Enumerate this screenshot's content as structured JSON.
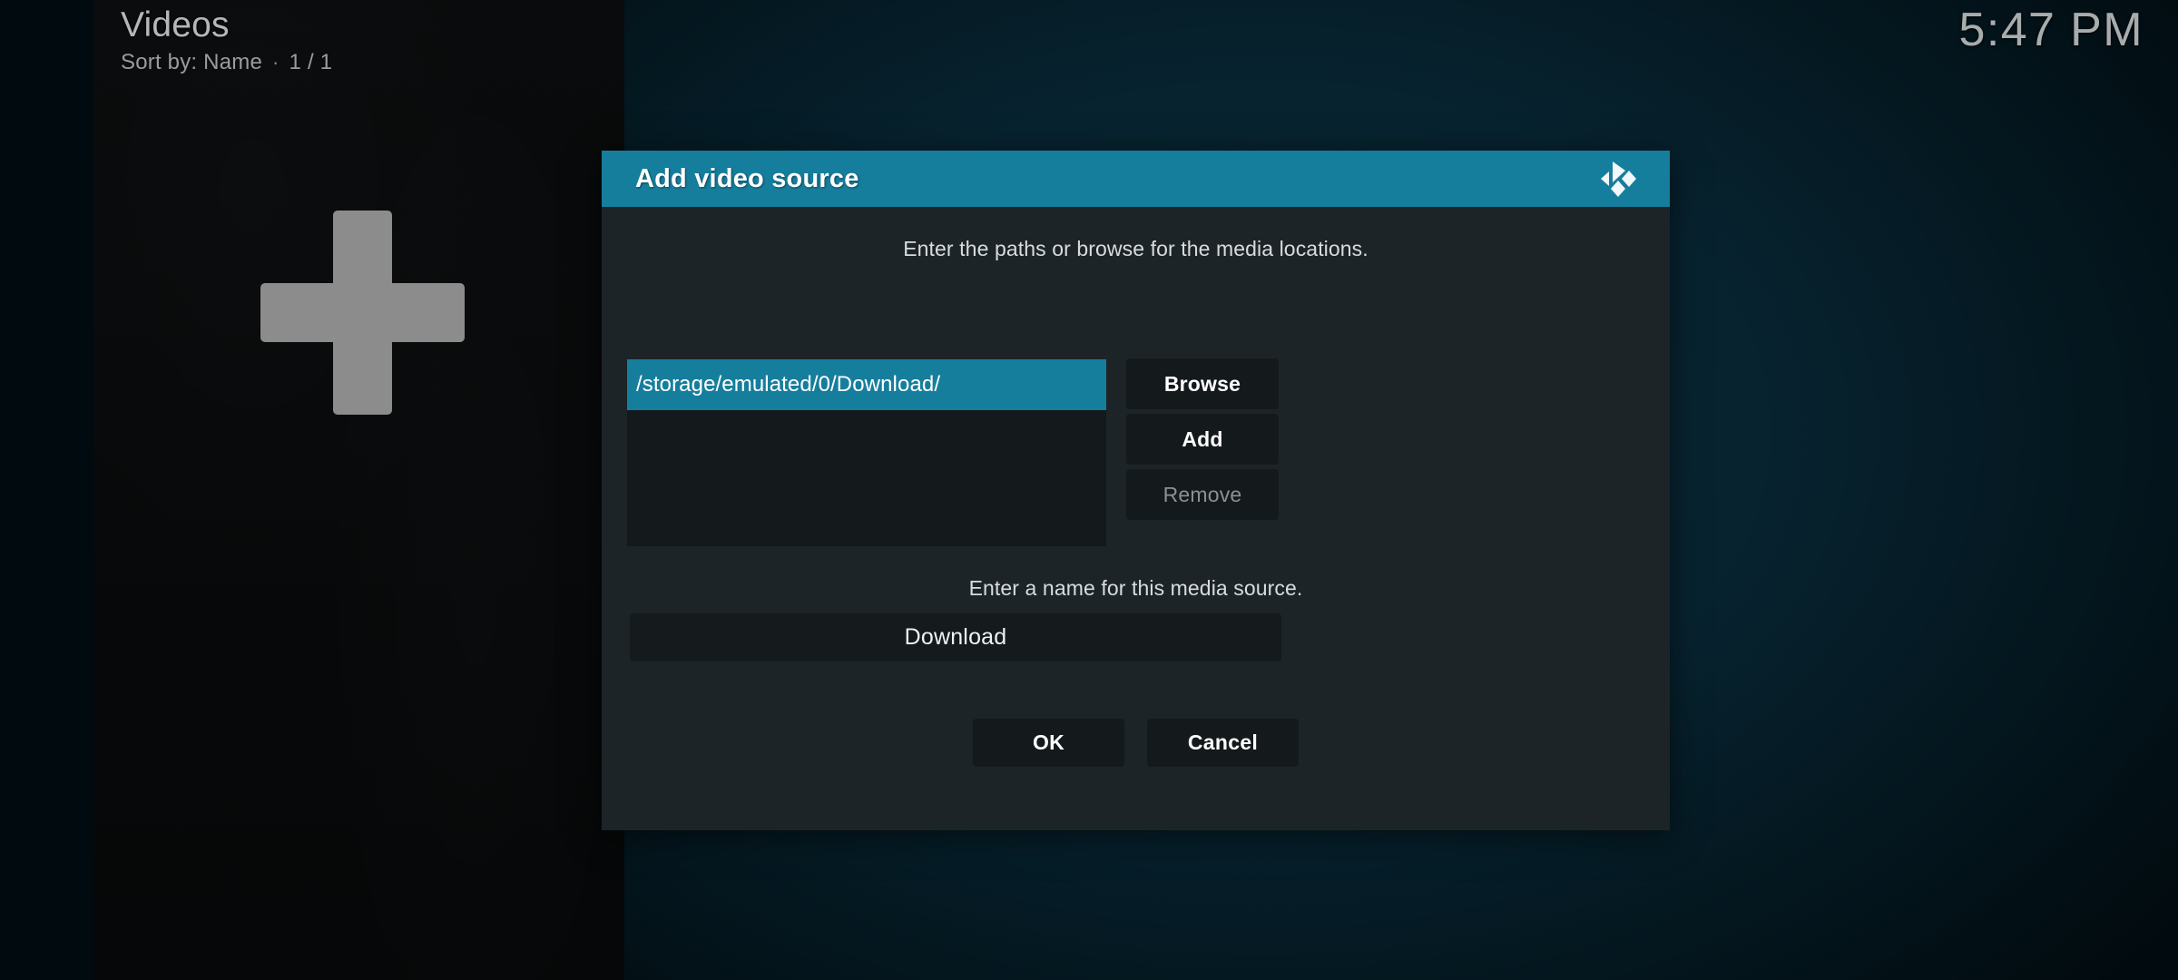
{
  "screen": {
    "page_title": "Videos",
    "sort_label": "Sort by: Name",
    "separator": "·",
    "page_count": "1 / 1",
    "clock": "5:47 PM",
    "add_source_icon": "plus-icon",
    "accent_color": "#167e9d",
    "dialog_bg_color": "#1d2427",
    "panel_bg_color": "#090b0c"
  },
  "dialog": {
    "title": "Add video source",
    "logo_icon": "kodi-logo-icon",
    "paths_hint": "Enter the paths or browse for the media locations.",
    "paths": [
      {
        "value": "/storage/emulated/0/Download/",
        "selected": true
      }
    ],
    "side_buttons": [
      {
        "label": "Browse",
        "disabled": false
      },
      {
        "label": "Add",
        "disabled": false
      },
      {
        "label": "Remove",
        "disabled": true
      }
    ],
    "name_hint": "Enter a name for this media source.",
    "name_value": "Download",
    "footer_buttons": [
      {
        "label": "OK"
      },
      {
        "label": "Cancel"
      }
    ]
  }
}
